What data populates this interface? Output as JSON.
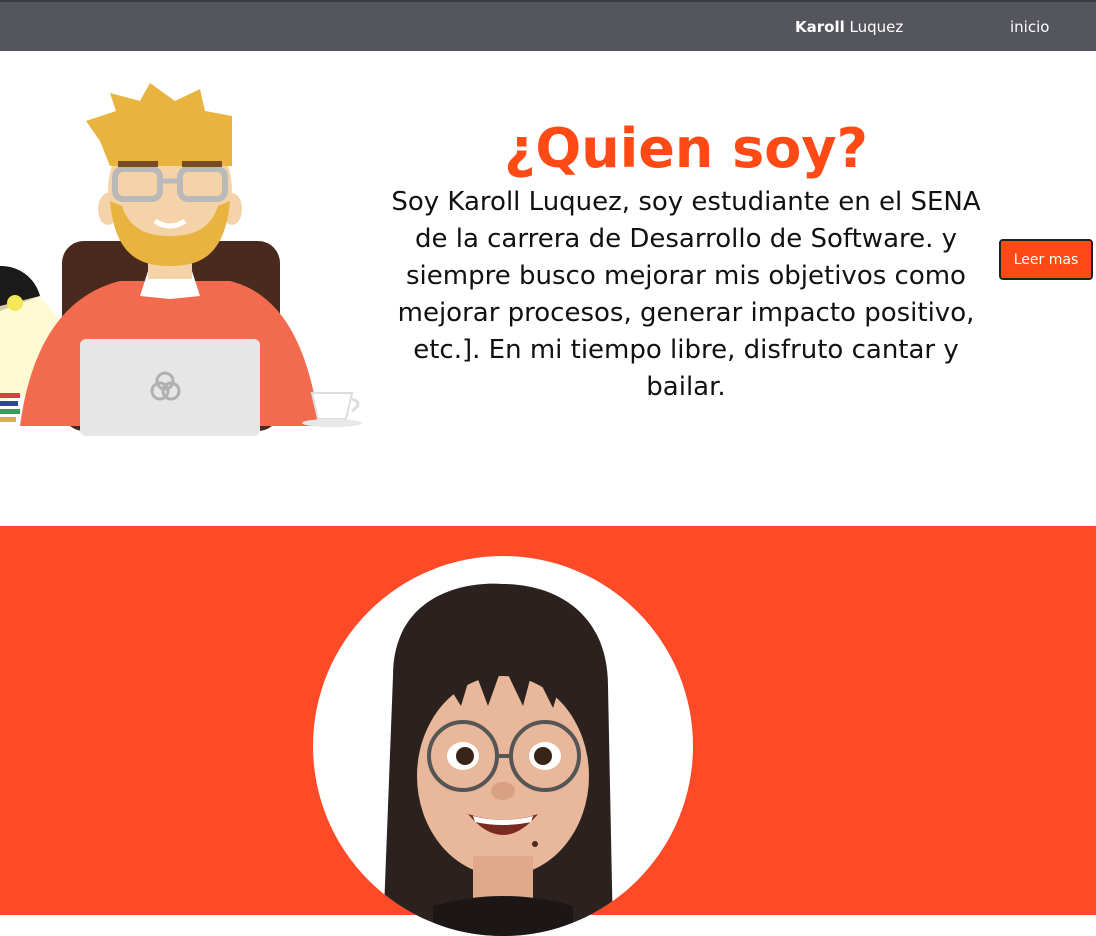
{
  "nav": {
    "brand_bold": "Karoll",
    "brand_rest": " Luquez",
    "link_inicio": "inicio"
  },
  "hero": {
    "title": "¿Quien soy?",
    "text": "Soy Karoll Luquez, soy estudiante en el SENA de la carrera de Desarrollo de Software. y siempre busco mejorar mis objetivos como mejorar procesos, generar impacto positivo, etc.]. En mi tiempo libre, disfruto cantar y bailar.",
    "button_label": "Leer mas"
  },
  "colors": {
    "accent": "#ff4a16",
    "section_bg": "#ff4a27",
    "navbar": "#55555e"
  },
  "icons": {
    "illustration": "developer-at-laptop-illustration",
    "avatar": "memoji-avatar"
  }
}
